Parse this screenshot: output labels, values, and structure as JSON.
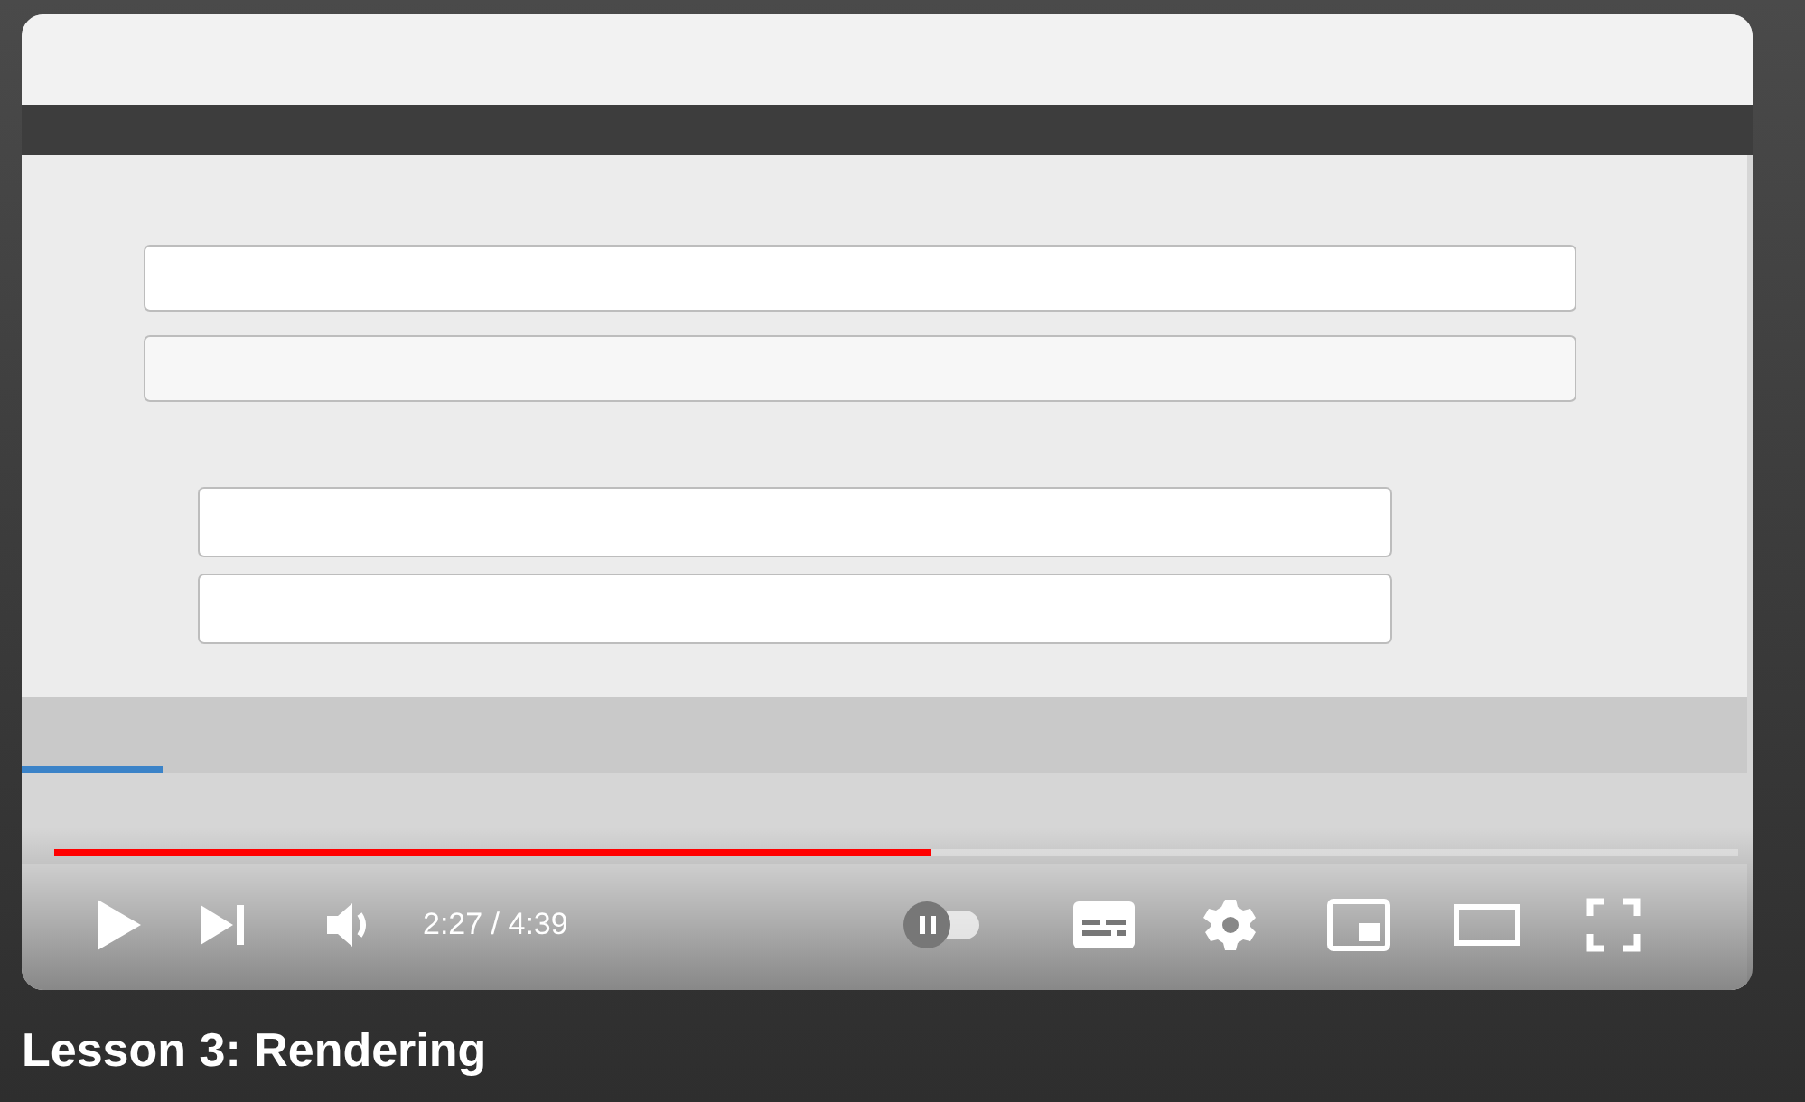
{
  "player": {
    "kind": "picture",
    "progress": {
      "level": 0.52
    },
    "time": "2:27 / 4:39",
    "autoplay": {
      "on": false
    }
  },
  "title": "Lesson 3: Rendering"
}
